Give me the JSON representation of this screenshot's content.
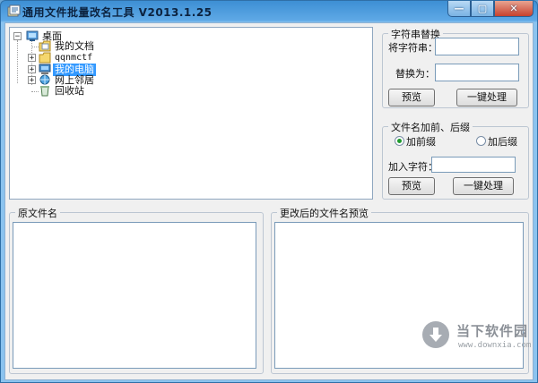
{
  "window": {
    "title": "通用文件批量改名工具  V2013.1.25",
    "minimize_glyph": "—",
    "maximize_glyph": "▢",
    "close_glyph": "✕"
  },
  "tree": {
    "root": {
      "label": "桌面",
      "icon": "desktop-icon",
      "expander": "−"
    },
    "items": [
      {
        "label": "我的文档",
        "icon": "documents-icon",
        "expander": ""
      },
      {
        "label": "qqnmctf",
        "icon": "folder-icon",
        "expander": "+"
      },
      {
        "label": "我的电脑",
        "icon": "computer-icon",
        "expander": "+",
        "selected": true
      },
      {
        "label": "网上邻居",
        "icon": "network-icon",
        "expander": "+"
      },
      {
        "label": "回收站",
        "icon": "recycle-bin-icon",
        "expander": ""
      }
    ]
  },
  "replace_group": {
    "title": "字符串替换",
    "find_label": "将字符串：",
    "find_value": "",
    "replace_label": "替换为：",
    "replace_value": "",
    "preview_label": "预览",
    "apply_label": "一键处理"
  },
  "affix_group": {
    "title": "文件名加前、后缀",
    "prefix_label": "加前缀",
    "suffix_label": "加后缀",
    "selected": "prefix",
    "add_chars_label": "加入字符：",
    "add_chars_value": "",
    "preview_label": "预览",
    "apply_label": "一键处理"
  },
  "original_group": {
    "title": "原文件名"
  },
  "preview_group": {
    "title": "更改后的文件名预览"
  },
  "watermark": {
    "name": "当下软件园",
    "url": "www.downxia.com"
  },
  "colors": {
    "selection": "#3399ff",
    "radio_dot": "#1e9a2d",
    "titlebar": "#5fa9e6"
  }
}
